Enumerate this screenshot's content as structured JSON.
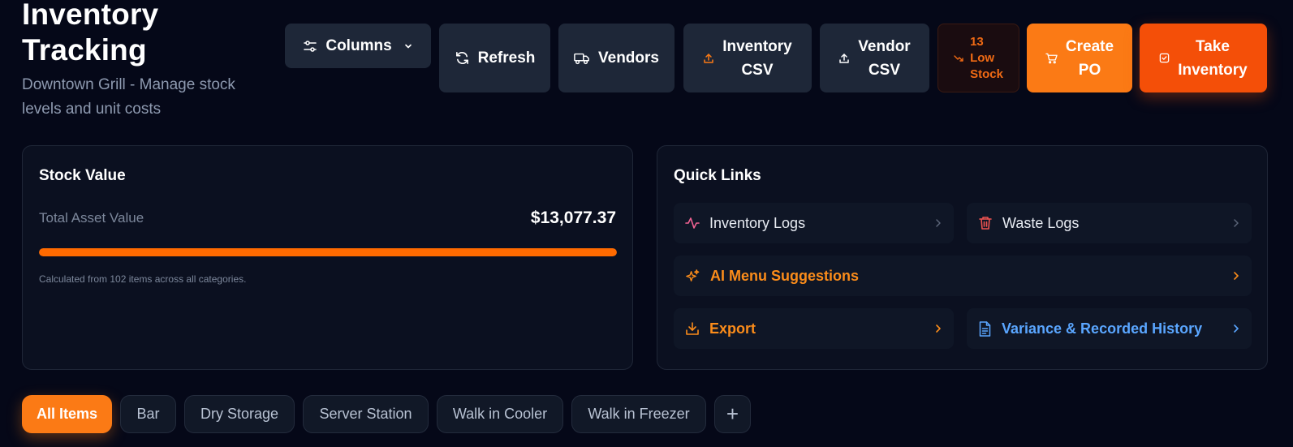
{
  "header": {
    "title": "Inventory Tracking",
    "subtitle": "Downtown Grill - Manage stock levels and unit costs"
  },
  "toolbar": {
    "columns_label": "Columns",
    "refresh_label": "Refresh",
    "vendors_label": "Vendors",
    "inventory_csv_line1": "Inventory",
    "inventory_csv_line2": "CSV",
    "vendor_csv_line1": "Vendor",
    "vendor_csv_line2": "CSV",
    "low_stock_count": "13",
    "low_stock_line2": "Low",
    "low_stock_line3": "Stock",
    "create_po_line1": "Create",
    "create_po_line2": "PO",
    "take_inventory_line1": "Take",
    "take_inventory_line2": "Inventory"
  },
  "stock_value": {
    "title": "Stock Value",
    "asset_label": "Total Asset Value",
    "asset_value": "$13,077.37",
    "bar_fill_percent": 100,
    "note": "Calculated from 102 items across all categories."
  },
  "quick_links": {
    "title": "Quick Links",
    "items": [
      {
        "label": "Inventory Logs",
        "icon": "activity-icon"
      },
      {
        "label": "Waste Logs",
        "icon": "trash-icon"
      },
      {
        "label": "AI Menu Suggestions",
        "icon": "sparkles-icon"
      },
      {
        "label": "Export",
        "icon": "download-icon"
      },
      {
        "label": "Variance & Recorded History",
        "icon": "document-icon"
      }
    ]
  },
  "tabs": {
    "items": [
      "All Items",
      "Bar",
      "Dry Storage",
      "Server Station",
      "Walk in Cooler",
      "Walk in Freezer"
    ],
    "active": "All Items",
    "add_label": "+"
  },
  "colors": {
    "background": "#050818",
    "card": "#0b1020",
    "button": "#1e2738",
    "accent_orange": "#fb7a15",
    "accent_deep_orange": "#f44f08",
    "low_stock_text": "#f06a14",
    "link_blue": "#5aa6ff",
    "pink_icon": "#f06292",
    "red_icon": "#ef5350"
  }
}
